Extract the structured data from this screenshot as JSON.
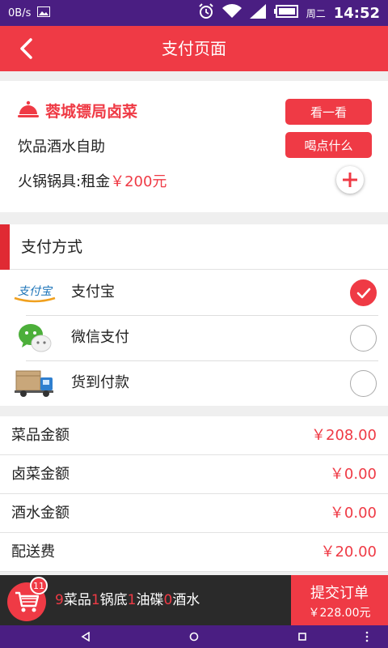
{
  "status_bar": {
    "net_speed": "0B/s",
    "day": "周二",
    "time": "14:52"
  },
  "app_bar": {
    "title": "支付页面"
  },
  "store": {
    "name": "蓉城镖局卤菜",
    "look_button": "看一看",
    "line2": "饮品酒水自助",
    "drink_button": "喝点什么",
    "rent_label": "火锅锅具:租金",
    "rent_price": "￥200元"
  },
  "payment": {
    "header": "支付方式",
    "methods": [
      {
        "name": "支付宝",
        "icon": "alipay-icon",
        "logo_text": "支付宝",
        "selected": true
      },
      {
        "name": "微信支付",
        "icon": "wechat-icon",
        "selected": false
      },
      {
        "name": "货到付款",
        "icon": "delivery-truck-icon",
        "selected": false
      }
    ]
  },
  "amounts": [
    {
      "label": "菜品金额",
      "value": "￥208.00"
    },
    {
      "label": "卤菜金额",
      "value": "￥0.00"
    },
    {
      "label": "酒水金额",
      "value": "￥0.00"
    },
    {
      "label": "配送费",
      "value": "￥20.00"
    }
  ],
  "cart": {
    "badge": "11",
    "dish_count": "9",
    "dish_label": "菜品",
    "pot_count": "1",
    "pot_label": "锅底",
    "dip_count": "1",
    "dip_label": "油碟",
    "drink_count": "0",
    "drink_label": "酒水",
    "submit_label": "提交订单",
    "total": "￥228.00元"
  },
  "colors": {
    "accent": "#ef3a45",
    "status_bar": "#4a1e82",
    "bottom_bar": "#2a2a2a"
  }
}
